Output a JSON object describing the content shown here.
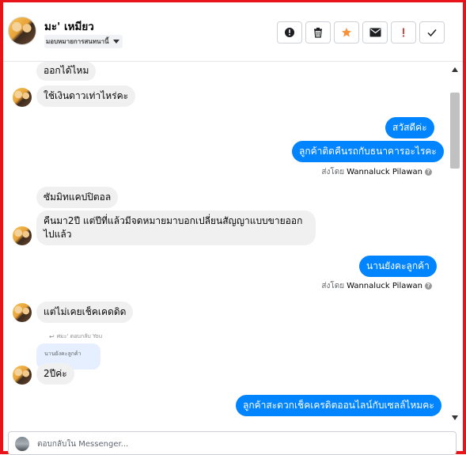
{
  "header": {
    "contact_name": "มะ' เหมียว",
    "assign_label": "มอบหมายการสนทนานี้",
    "toolbar": [
      {
        "name": "mark-spam-button",
        "icon": "alert-circle-icon"
      },
      {
        "name": "delete-button",
        "icon": "trash-icon"
      },
      {
        "name": "star-button",
        "icon": "star-icon"
      },
      {
        "name": "mark-unread-button",
        "icon": "envelope-icon"
      },
      {
        "name": "follow-up-button",
        "icon": "exclamation-icon"
      },
      {
        "name": "mark-done-button",
        "icon": "checkmark-icon"
      }
    ]
  },
  "messages": {
    "m1": "ออกได้ไหม",
    "m2": "ใช้เงินดาวเท่าไหร่คะ",
    "m3": "สวัสดีค่ะ",
    "m4": "ลูกค้าติดคืนรถกับธนาคารอะไรคะ",
    "sent_by_1_prefix": "ส่งโดย",
    "sent_by_1_name": "Wannaluck Pilawan",
    "m5": "ซัมมิทแคปปิตอล",
    "m6": "คืนมา2ปี แต่ปีที่แล้วมีจดหมายมาบอกเปลี่ยนสัญญาแบบขายออกไปแล้ว",
    "m7": "นานยังคะลูกค้า",
    "sent_by_2_prefix": "ส่งโดย",
    "sent_by_2_name": "Wannaluck Pilawan",
    "m8": "แต่ไม่เคยเช็คเคดดิด",
    "reply_meta": "ศ​มะ' ตอบกลับ You",
    "quoted_text": "นานยังคะลูกค้า",
    "m9": "2ปีค่ะ",
    "m10": "ลูกค้าสะดวกเช็คเครดิตออนไลน์กับเซลล์ไหมคะ"
  },
  "composer": {
    "placeholder": "ตอบกลับใน Messenger..."
  },
  "colors": {
    "frame": "#e8141a",
    "outgoing_bubble": "#0084ff",
    "incoming_bubble": "#f0f0f0",
    "star": "#f7923b",
    "follow_up": "#e4403a"
  }
}
